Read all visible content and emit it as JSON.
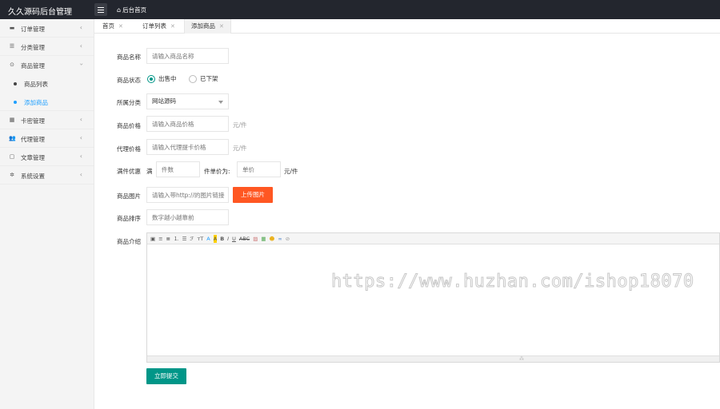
{
  "app": {
    "title": "久久源码后台管理",
    "home_label": "后台首页"
  },
  "sidebar": {
    "items": [
      {
        "label": "订单管理",
        "icon": "credit-card-icon"
      },
      {
        "label": "分类管理",
        "icon": "list-icon"
      },
      {
        "label": "商品管理",
        "icon": "gift-icon",
        "expanded": true
      },
      {
        "label": "卡密管理",
        "icon": "grid-icon"
      },
      {
        "label": "代理管理",
        "icon": "users-icon"
      },
      {
        "label": "文章管理",
        "icon": "document-icon"
      },
      {
        "label": "系统设置",
        "icon": "settings-icon"
      }
    ],
    "sub_items": [
      {
        "label": "商品列表",
        "active": false
      },
      {
        "label": "添加商品",
        "active": true
      }
    ]
  },
  "tabs": [
    {
      "label": "首页"
    },
    {
      "label": "订单列表"
    },
    {
      "label": "添加商品",
      "active": true
    }
  ],
  "form": {
    "name_label": "商品名称",
    "name_placeholder": "请输入商品名称",
    "status_label": "商品状态",
    "status_options": [
      "出售中",
      "已下架"
    ],
    "status_selected": "出售中",
    "category_label": "所属分类",
    "category_value": "网站源码",
    "price_label": "商品价格",
    "price_placeholder": "请输入商品价格",
    "price_unit": "元/件",
    "agent_price_label": "代理价格",
    "agent_price_placeholder": "请输入代理提卡价格",
    "agent_price_unit": "元/件",
    "bulk_label": "满件优惠",
    "bulk_prefix": "满",
    "bulk_qty_placeholder": "件数",
    "bulk_mid_text": "件单价为:",
    "bulk_price_placeholder": "单价",
    "bulk_unit": "元/件",
    "image_label": "商品图片",
    "image_placeholder": "请输入带http://的图片链接",
    "upload_label": "上传图片",
    "sort_label": "商品排序",
    "sort_placeholder": "数字越小越靠前",
    "intro_label": "商品介绍",
    "submit_label": "立即提交"
  },
  "editor_toolbar": [
    "source-icon",
    "align-left-icon",
    "align-center-icon",
    "ordered-list-icon",
    "unordered-list-icon",
    "font-family-icon",
    "font-size-icon",
    "font-color-icon",
    "highlight-icon",
    "bold-icon",
    "italic-icon",
    "underline-icon",
    "strikethrough-icon",
    "image-icon",
    "table-icon",
    "emoticon-icon",
    "link-icon",
    "unlink-icon"
  ],
  "watermark": "https://www.huzhan.com/ishop18070",
  "colors": {
    "topbar": "#23262e",
    "primary": "#009688",
    "accent": "#ff5722",
    "active_link": "#1e9fff"
  }
}
